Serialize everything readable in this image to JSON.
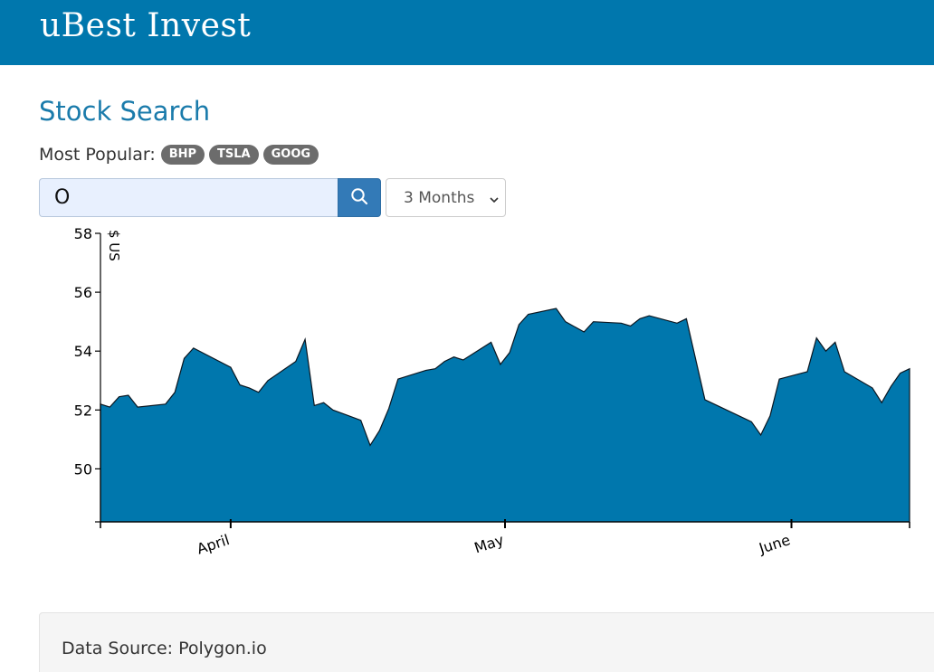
{
  "header": {
    "brand": "uBest Invest"
  },
  "page": {
    "title": "Stock Search"
  },
  "popular": {
    "label": "Most Popular:",
    "tickers": [
      "BHP",
      "TSLA",
      "GOOG"
    ]
  },
  "search": {
    "value": "O",
    "placeholder": "",
    "button_icon": "search-icon"
  },
  "range_select": {
    "selected": "3 Months"
  },
  "colors": {
    "brand": "#0077ad",
    "chart_fill": "#0077ad",
    "button": "#337ab7"
  },
  "chart_data": {
    "type": "area",
    "ylabel": "$ US",
    "ylim": [
      48.2,
      58
    ],
    "yticks": [
      50,
      52,
      54,
      56,
      58
    ],
    "xlim": [
      0,
      87
    ],
    "xticks": [
      {
        "label": "April",
        "x": 14
      },
      {
        "label": "May",
        "x": 43.5
      },
      {
        "label": "June",
        "x": 74.3
      }
    ],
    "grid": false,
    "points": [
      [
        0,
        52.2
      ],
      [
        1,
        52.1
      ],
      [
        2,
        52.45
      ],
      [
        3,
        52.5
      ],
      [
        4,
        52.1
      ],
      [
        7,
        52.2
      ],
      [
        8,
        52.6
      ],
      [
        9,
        53.75
      ],
      [
        10,
        54.1
      ],
      [
        14,
        53.45
      ],
      [
        15,
        52.85
      ],
      [
        16,
        52.75
      ],
      [
        17,
        52.6
      ],
      [
        18,
        53.0
      ],
      [
        21,
        53.65
      ],
      [
        22,
        54.4
      ],
      [
        23,
        52.15
      ],
      [
        24,
        52.25
      ],
      [
        25,
        52.0
      ],
      [
        28,
        51.65
      ],
      [
        29,
        50.8
      ],
      [
        30,
        51.3
      ],
      [
        31,
        52.05
      ],
      [
        32,
        53.05
      ],
      [
        35,
        53.35
      ],
      [
        36,
        53.4
      ],
      [
        37,
        53.65
      ],
      [
        38,
        53.8
      ],
      [
        39,
        53.7
      ],
      [
        42,
        54.3
      ],
      [
        43,
        53.55
      ],
      [
        44,
        53.95
      ],
      [
        45,
        54.9
      ],
      [
        46,
        55.25
      ],
      [
        49,
        55.45
      ],
      [
        50,
        55.0
      ],
      [
        52,
        54.65
      ],
      [
        53,
        55.0
      ],
      [
        56,
        54.95
      ],
      [
        57,
        54.85
      ],
      [
        58,
        55.1
      ],
      [
        59,
        55.2
      ],
      [
        62,
        54.95
      ],
      [
        63,
        55.1
      ],
      [
        65,
        52.35
      ],
      [
        70,
        51.6
      ],
      [
        71,
        51.15
      ],
      [
        72,
        51.8
      ],
      [
        73,
        53.05
      ],
      [
        76,
        53.3
      ],
      [
        77,
        54.45
      ],
      [
        78,
        54.0
      ],
      [
        79,
        54.3
      ],
      [
        80,
        53.3
      ],
      [
        83,
        52.75
      ],
      [
        84,
        52.25
      ],
      [
        85,
        52.8
      ],
      [
        86,
        53.25
      ],
      [
        87,
        53.4
      ]
    ]
  },
  "footer": {
    "text": "Data Source: Polygon.io"
  }
}
